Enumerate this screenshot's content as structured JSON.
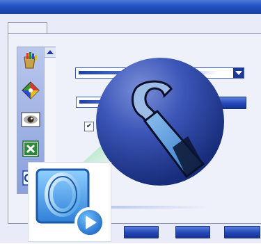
{
  "window": {
    "titlebar_color": "#2151c4"
  },
  "sidebar": {
    "items": [
      {
        "icon": "paint-palette-icon"
      },
      {
        "icon": "color-picker-icon"
      },
      {
        "icon": "eye-icon"
      },
      {
        "icon": "excel-icon"
      },
      {
        "icon": "outlook-icon"
      }
    ]
  },
  "form": {
    "checkbox_checked": true,
    "check_glyph": "✔"
  },
  "overlay": {
    "icon": "wrench-icon"
  },
  "app_logo": {
    "icon": "outlook-logo-icon"
  },
  "colors": {
    "accent": "#1d3a97",
    "panel": "#eef1fa",
    "globe": "#2b3f9a"
  }
}
